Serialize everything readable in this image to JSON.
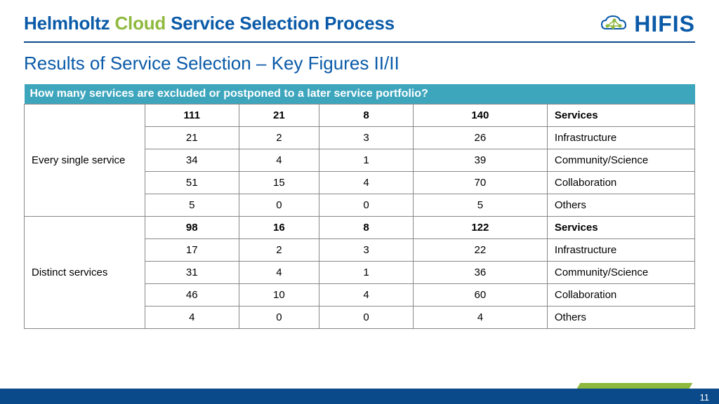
{
  "header": {
    "title_parts": {
      "p1": "Helmholtz",
      "p2": "Cloud",
      "p3": "Service Selection Process"
    },
    "logo_text": "HIFIS"
  },
  "subtitle": "Results of Service Selection – Key Figures II/II",
  "table": {
    "question": "How many services are excluded or postponed to a later service portfolio?",
    "groups": [
      {
        "head": "Every single service",
        "rows": [
          {
            "bold": true,
            "c1": "111",
            "c2": "21",
            "c3": "8",
            "c4": "140",
            "cat": "Services"
          },
          {
            "bold": false,
            "c1": "21",
            "c2": "2",
            "c3": "3",
            "c4": "26",
            "cat": "Infrastructure"
          },
          {
            "bold": false,
            "c1": "34",
            "c2": "4",
            "c3": "1",
            "c4": "39",
            "cat": "Community/Science"
          },
          {
            "bold": false,
            "c1": "51",
            "c2": "15",
            "c3": "4",
            "c4": "70",
            "cat": "Collaboration"
          },
          {
            "bold": false,
            "c1": "5",
            "c2": "0",
            "c3": "0",
            "c4": "5",
            "cat": "Others"
          }
        ]
      },
      {
        "head": "Distinct services",
        "rows": [
          {
            "bold": true,
            "c1": "98",
            "c2": "16",
            "c3": "8",
            "c4": "122",
            "cat": "Services"
          },
          {
            "bold": false,
            "c1": "17",
            "c2": "2",
            "c3": "3",
            "c4": "22",
            "cat": "Infrastructure"
          },
          {
            "bold": false,
            "c1": "31",
            "c2": "4",
            "c3": "1",
            "c4": "36",
            "cat": "Community/Science"
          },
          {
            "bold": false,
            "c1": "46",
            "c2": "10",
            "c3": "4",
            "c4": "60",
            "cat": "Collaboration"
          },
          {
            "bold": false,
            "c1": "4",
            "c2": "0",
            "c3": "0",
            "c4": "4",
            "cat": "Others"
          }
        ]
      }
    ]
  },
  "page_number": "11"
}
